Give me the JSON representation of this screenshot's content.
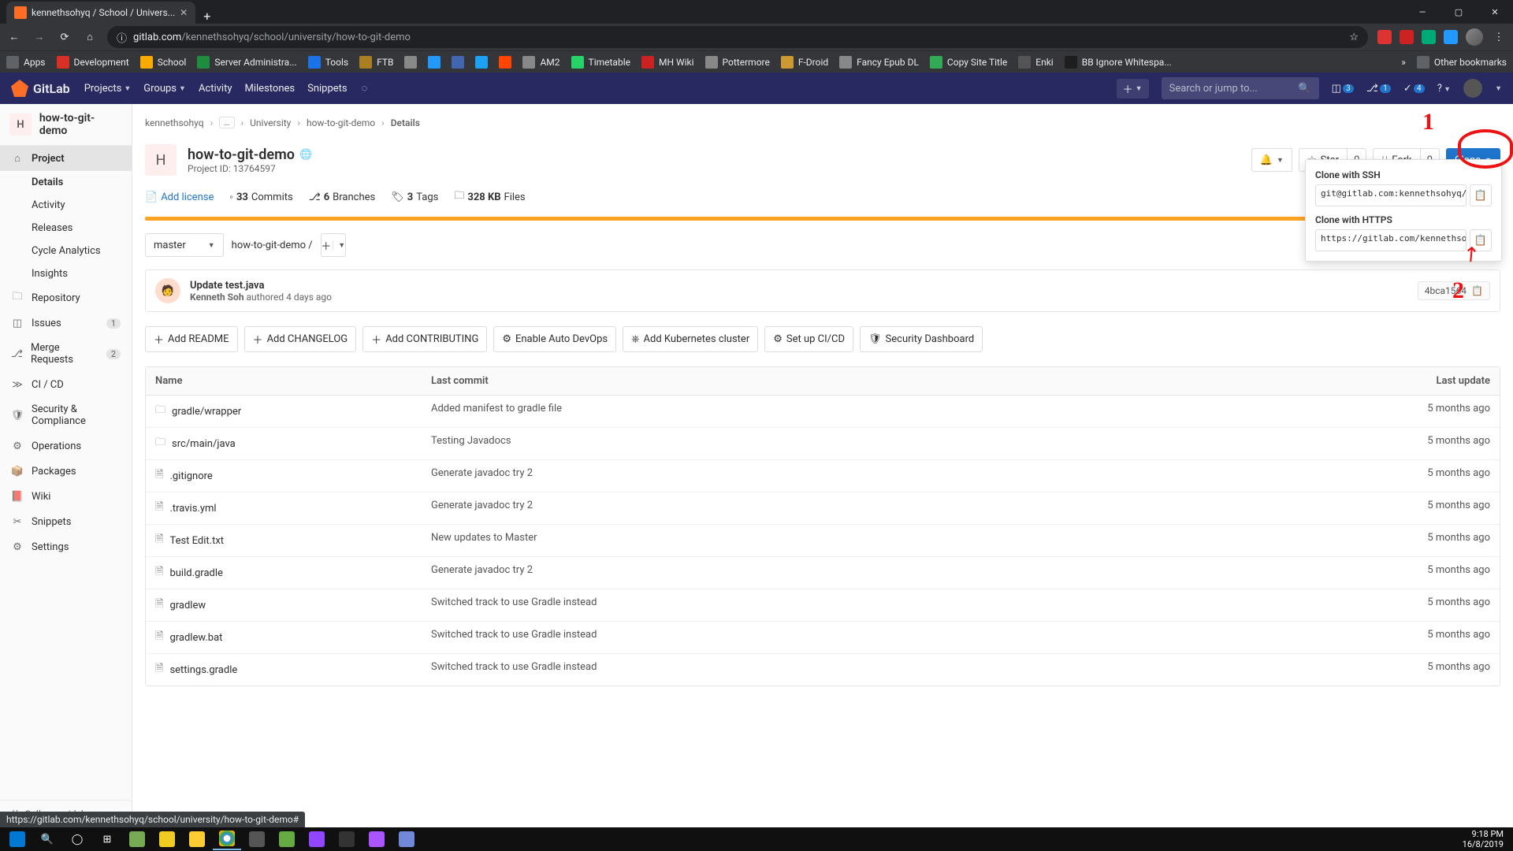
{
  "browser": {
    "tab_title": "kennethsohyq / School / Univers...",
    "url_host": "gitlab.com",
    "url_path": "/kennethsohyq/school/university/how-to-git-demo",
    "bookmarks": [
      "Apps",
      "Development",
      "School",
      "Server Administra...",
      "Tools",
      "FTB",
      "",
      "",
      "",
      "",
      "",
      "AM2",
      "Timetable",
      "MH Wiki",
      "Pottermore",
      "F-Droid",
      "Fancy Epub DL",
      "Copy Site Title",
      "Enki",
      "BB Ignore Whitespa..."
    ],
    "other_bookmarks": "Other bookmarks"
  },
  "gitlab_nav": {
    "brand": "GitLab",
    "items": [
      "Projects",
      "Groups",
      "Activity",
      "Milestones",
      "Snippets"
    ],
    "search_placeholder": "Search or jump to...",
    "badges": {
      "issues": "3",
      "mrs": "1",
      "todos": "4"
    }
  },
  "sidebar": {
    "title": "how-to-git-demo",
    "title_initial": "H",
    "items": [
      {
        "icon": "home",
        "label": "Project",
        "active": true,
        "sub": [
          {
            "label": "Details",
            "active": true
          },
          {
            "label": "Activity"
          },
          {
            "label": "Releases"
          },
          {
            "label": "Cycle Analytics"
          },
          {
            "label": "Insights"
          }
        ]
      },
      {
        "icon": "repo",
        "label": "Repository"
      },
      {
        "icon": "issues",
        "label": "Issues",
        "count": "1"
      },
      {
        "icon": "mr",
        "label": "Merge Requests",
        "count": "2"
      },
      {
        "icon": "cicd",
        "label": "CI / CD"
      },
      {
        "icon": "shield",
        "label": "Security & Compliance"
      },
      {
        "icon": "ops",
        "label": "Operations"
      },
      {
        "icon": "package",
        "label": "Packages"
      },
      {
        "icon": "wiki",
        "label": "Wiki"
      },
      {
        "icon": "snip",
        "label": "Snippets"
      },
      {
        "icon": "gear",
        "label": "Settings"
      }
    ],
    "collapse": "Collapse sidebar"
  },
  "breadcrumb": [
    "kennethsohyq",
    "…",
    "University",
    "how-to-git-demo",
    "Details"
  ],
  "project": {
    "initial": "H",
    "name": "how-to-git-demo",
    "id_label": "Project ID: 13764597",
    "star": "Star",
    "star_count": "0",
    "fork": "Fork",
    "fork_count": "0",
    "clone": "Clone"
  },
  "meta": {
    "add_license": "Add license",
    "commits": "33",
    "commits_label": "Commits",
    "branches": "6",
    "branches_label": "Branches",
    "tags": "3",
    "tags_label": "Tags",
    "size": "328 KB",
    "size_label": "Files"
  },
  "branch": "master",
  "path_root": "how-to-git-demo",
  "commit": {
    "title": "Update test.java",
    "author": "Kenneth Soh",
    "authored": "authored 4 days ago",
    "hash": "4bca1564"
  },
  "actions": [
    "Add README",
    "Add CHANGELOG",
    "Add CONTRIBUTING",
    "Enable Auto DevOps",
    "Add Kubernetes cluster",
    "Set up CI/CD",
    "Security Dashboard"
  ],
  "table": {
    "head": {
      "name": "Name",
      "commit": "Last commit",
      "update": "Last update"
    },
    "rows": [
      {
        "icon": "folder",
        "name": "gradle/wrapper",
        "commit": "Added manifest to gradle file",
        "update": "5 months ago"
      },
      {
        "icon": "folder",
        "name": "src/main/java",
        "commit": "Testing Javadocs",
        "update": "5 months ago"
      },
      {
        "icon": "file",
        "name": ".gitignore",
        "commit": "Generate javadoc try 2",
        "update": "5 months ago"
      },
      {
        "icon": "file",
        "name": ".travis.yml",
        "commit": "Generate javadoc try 2",
        "update": "5 months ago"
      },
      {
        "icon": "file",
        "name": "Test Edit.txt",
        "commit": "New updates to Master",
        "update": "5 months ago"
      },
      {
        "icon": "file",
        "name": "build.gradle",
        "commit": "Generate javadoc try 2",
        "update": "5 months ago"
      },
      {
        "icon": "file",
        "name": "gradlew",
        "commit": "Switched track to use Gradle instead",
        "update": "5 months ago"
      },
      {
        "icon": "file",
        "name": "gradlew.bat",
        "commit": "Switched track to use Gradle instead",
        "update": "5 months ago"
      },
      {
        "icon": "file",
        "name": "settings.gradle",
        "commit": "Switched track to use Gradle instead",
        "update": "5 months ago"
      }
    ]
  },
  "clone_pop": {
    "ssh_label": "Clone with SSH",
    "ssh": "git@gitlab.com:kennethsohyq/sch",
    "https_label": "Clone with HTTPS",
    "https": "https://gitlab.com/kennethsohyq"
  },
  "status_link": "https://gitlab.com/kennethsohyq/school/university/how-to-git-demo#",
  "taskbar": {
    "time": "9:18 PM",
    "date": "16/8/2019"
  },
  "annotations": {
    "one": "1",
    "two": "2"
  }
}
